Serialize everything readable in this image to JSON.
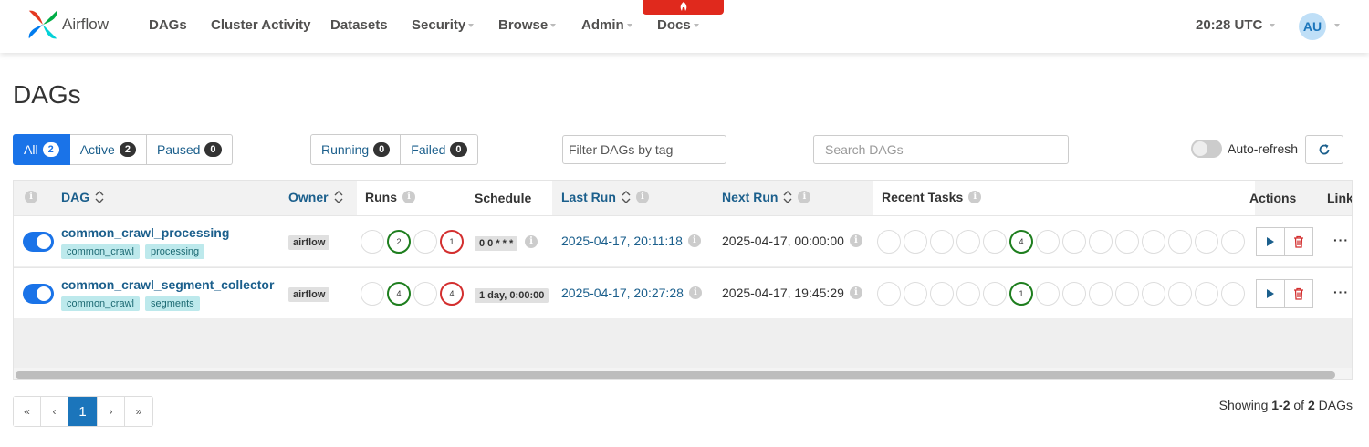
{
  "navbar": {
    "brand": "Airflow",
    "items": [
      {
        "label": "DAGs",
        "dropdown": false
      },
      {
        "label": "Cluster Activity",
        "dropdown": false
      },
      {
        "label": "Datasets",
        "dropdown": false
      },
      {
        "label": "Security",
        "dropdown": true
      },
      {
        "label": "Browse",
        "dropdown": true
      },
      {
        "label": "Admin",
        "dropdown": true
      },
      {
        "label": "Docs",
        "dropdown": true
      }
    ],
    "clock": "20:28 UTC",
    "avatar": "AU",
    "banner_color": "#e0291d"
  },
  "page_title": "DAGs",
  "filters": {
    "status": [
      {
        "label": "All",
        "count": "2",
        "active": true
      },
      {
        "label": "Active",
        "count": "2",
        "active": false
      },
      {
        "label": "Paused",
        "count": "0",
        "active": false
      }
    ],
    "run_state": [
      {
        "label": "Running",
        "count": "0"
      },
      {
        "label": "Failed",
        "count": "0"
      }
    ],
    "tag_filter_placeholder": "Filter DAGs by tag",
    "search_placeholder": "Search DAGs",
    "auto_refresh_label": "Auto-refresh",
    "auto_refresh_on": false
  },
  "table": {
    "columns": {
      "dag": "DAG",
      "owner": "Owner",
      "runs": "Runs",
      "schedule": "Schedule",
      "last_run": "Last Run",
      "next_run": "Next Run",
      "recent_tasks": "Recent Tasks",
      "actions": "Actions",
      "links": "Links"
    },
    "rows": [
      {
        "name": "common_crawl_processing",
        "tags": [
          "common_crawl",
          "processing"
        ],
        "owner": "airflow",
        "runs": [
          "",
          "2",
          "",
          "1"
        ],
        "schedule": "0 0 * * *",
        "last_run": "2025-04-17, 20:11:18",
        "next_run": "2025-04-17, 00:00:00",
        "recent_tasks": [
          "",
          "",
          "",
          "",
          "",
          "4",
          "",
          "",
          "",
          "",
          "",
          "",
          "",
          ""
        ],
        "enabled": true
      },
      {
        "name": "common_crawl_segment_collector",
        "tags": [
          "common_crawl",
          "segments"
        ],
        "owner": "airflow",
        "runs": [
          "",
          "4",
          "",
          "4"
        ],
        "schedule": "1 day, 0:00:00",
        "last_run": "2025-04-17, 20:27:28",
        "next_run": "2025-04-17, 19:45:29",
        "recent_tasks": [
          "",
          "",
          "",
          "",
          "",
          "1",
          "",
          "",
          "",
          "",
          "",
          "",
          "",
          ""
        ],
        "enabled": true
      }
    ]
  },
  "pagination": {
    "first": "«",
    "prev": "‹",
    "current": "1",
    "next": "›",
    "last": "»"
  },
  "showing": {
    "prefix": "Showing ",
    "range": "1-2",
    "of": " of ",
    "total": "2",
    "suffix": " DAGs"
  },
  "colors": {
    "primary": "#1a73e8",
    "link": "#1b5f8c",
    "success": "#1e7e1e",
    "failed": "#d32f2f",
    "tag_bg": "#bde9ec"
  }
}
